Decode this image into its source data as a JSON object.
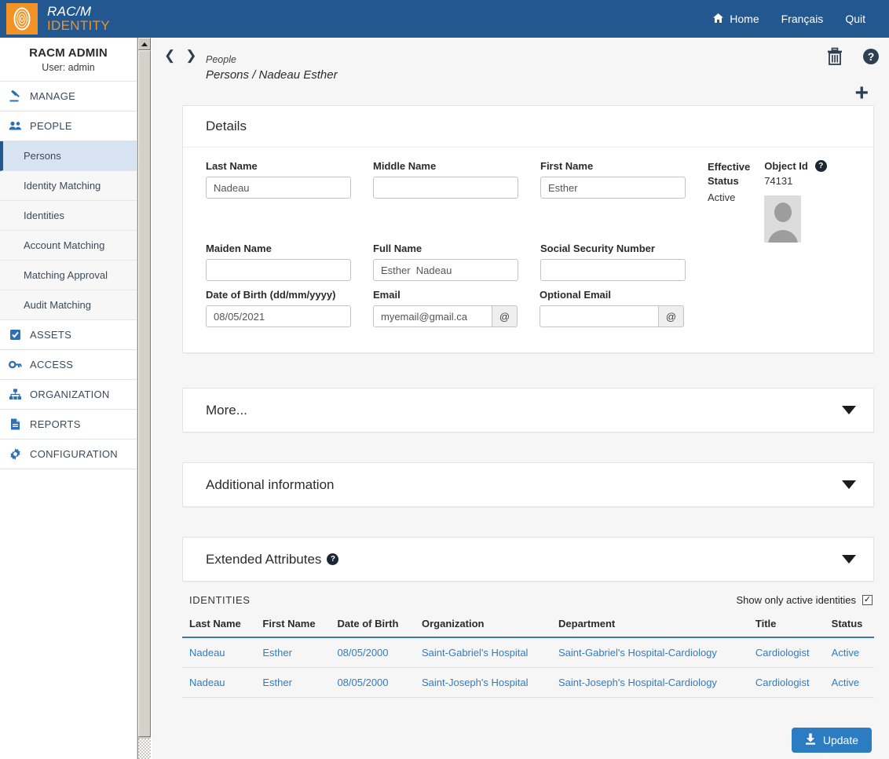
{
  "brand": {
    "line1": "RAC/M",
    "line2": "IDENTITY",
    "logo_color": "#f29225",
    "bar_color": "#22578f"
  },
  "topnav": [
    {
      "label": "Home",
      "icon": "home-icon"
    },
    {
      "label": "Français",
      "icon": ""
    },
    {
      "label": "Quit",
      "icon": ""
    }
  ],
  "sidebar": {
    "user_name": "RACM ADMIN",
    "user_sub": "User: admin",
    "groups": [
      {
        "label": "MANAGE",
        "icon": "gavel-icon"
      },
      {
        "label": "PEOPLE",
        "icon": "people-icon"
      }
    ],
    "sub_items": [
      {
        "label": "Persons",
        "active": true
      },
      {
        "label": "Identity Matching",
        "active": false
      },
      {
        "label": "Identities",
        "active": false
      },
      {
        "label": "Account Matching",
        "active": false
      },
      {
        "label": "Matching Approval",
        "active": false
      },
      {
        "label": "Audit Matching",
        "active": false
      }
    ],
    "groups_lower": [
      {
        "label": "ASSETS",
        "icon": "clipboard-check-icon"
      },
      {
        "label": "ACCESS",
        "icon": "key-icon"
      },
      {
        "label": "ORGANIZATION",
        "icon": "org-chart-icon"
      },
      {
        "label": "REPORTS",
        "icon": "document-icon"
      },
      {
        "label": "CONFIGURATION",
        "icon": "gear-icon"
      }
    ]
  },
  "breadcrumb": {
    "parent": "People",
    "current": "Persons / Nadeau Esther"
  },
  "header_actions": {
    "delete": "trash-icon",
    "help": "help-icon",
    "add": "plus-icon"
  },
  "details": {
    "title": "Details",
    "fields": {
      "last_name_label": "Last Name",
      "last_name_value": "Nadeau",
      "middle_name_label": "Middle Name",
      "middle_name_value": "",
      "first_name_label": "First Name",
      "first_name_value": "Esther",
      "maiden_name_label": "Maiden Name",
      "maiden_name_value": "",
      "full_name_label": "Full Name",
      "full_name_value": "Esther  Nadeau",
      "ssn_label": "Social Security Number",
      "ssn_value": "",
      "dob_label": "Date of Birth (dd/mm/yyyy)",
      "dob_value": "08/05/2021",
      "email_label": "Email",
      "email_value": "myemail@gmail.ca",
      "email_addon": "@",
      "opt_email_label": "Optional Email",
      "opt_email_value": "",
      "opt_email_addon": "@"
    },
    "effective_status_label_1": "Effective",
    "effective_status_label_2": "Status",
    "effective_status_value": "Active",
    "object_id_label": "Object Id",
    "object_id_value": "74131"
  },
  "accordions": [
    {
      "label": "More...",
      "has_help": false
    },
    {
      "label": "Additional information",
      "has_help": false
    },
    {
      "label": "Extended Attributes",
      "has_help": true
    }
  ],
  "identities": {
    "title": "IDENTITIES",
    "filter_label": "Show only active identities",
    "filter_checked": true,
    "columns": [
      "Last Name",
      "First Name",
      "Date of Birth",
      "Organization",
      "Department",
      "Title",
      "Status"
    ],
    "rows": [
      [
        "Nadeau",
        "Esther",
        "08/05/2000",
        "Saint-Gabriel's Hospital",
        "Saint-Gabriel's Hospital-Cardiology",
        "Cardiologist",
        "Active"
      ],
      [
        "Nadeau",
        "Esther",
        "08/05/2000",
        "Saint-Joseph's Hospital",
        "Saint-Joseph's Hospital-Cardiology",
        "Cardiologist",
        "Active"
      ]
    ],
    "link_color": "#2f7cc4"
  },
  "update_button": {
    "label": "Update",
    "icon": "download-icon",
    "color": "#2b7cc0"
  }
}
